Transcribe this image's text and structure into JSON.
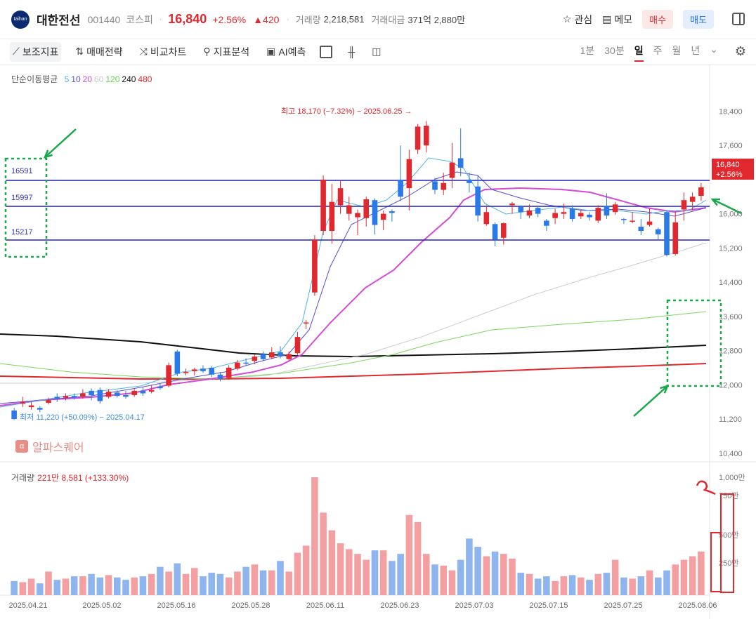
{
  "header": {
    "logo_text": "taihan",
    "name": "대한전선",
    "code": "001440",
    "market": "코스피",
    "price": "16,840",
    "change_pct": "+2.56%",
    "change_abs": "▲420",
    "volume_label": "거래량",
    "volume_value": "2,218,581",
    "amount_label": "거래대금",
    "amount_value": "371억 2,880만",
    "watch_label": "관심",
    "memo_label": "메모",
    "buy_label": "매수",
    "sell_label": "매도"
  },
  "toolbar": {
    "tools": [
      "보조지표",
      "매매전략",
      "비교차트",
      "지표분석",
      "AI예측"
    ],
    "periods": [
      "1분",
      "30분",
      "일",
      "주",
      "월",
      "년"
    ],
    "selected_period": "일"
  },
  "legend": {
    "ma_title": "단순이동평균",
    "ma_periods": [
      {
        "label": "5",
        "color": "#4fb3e8"
      },
      {
        "label": "10",
        "color": "#5a4bd6"
      },
      {
        "label": "20",
        "color": "#d64bd6"
      },
      {
        "label": "60",
        "color": "#cccccc"
      },
      {
        "label": "120",
        "color": "#5ad64b"
      },
      {
        "label": "240",
        "color": "#111111"
      },
      {
        "label": "480",
        "color": "#e0282e"
      }
    ],
    "volume_title": "거래량",
    "volume_value": "221만 8,581 (+133.30%)"
  },
  "watermark": "알파스퀘어",
  "annotations": {
    "high": "최고 18,170 (−7.32%) − 2025.06.25 →",
    "low": "← 최저 11,220 (+50.09%) − 2025.04.17"
  },
  "price_tag": {
    "price": "16,840",
    "pct": "+2.56%"
  },
  "hlines": [
    {
      "label": "16591",
      "value": 16591
    },
    {
      "label": "15997",
      "value": 15997
    },
    {
      "label": "15217",
      "value": 15217
    }
  ],
  "chart_data": {
    "type": "candlestick",
    "y_axis_ticks": [
      "18,400",
      "17,600",
      "16,000",
      "15,200",
      "14,400",
      "13,600",
      "12,800",
      "12,000",
      "11,200",
      "10,400"
    ],
    "x_axis_ticks": [
      "2025.04.21",
      "2025.05.02",
      "2025.05.16",
      "2025.05.28",
      "2025.06.11",
      "2025.06.23",
      "2025.07.03",
      "2025.07.15",
      "2025.07.25",
      "2025.08.06"
    ],
    "volume_ticks": [
      "1,000만",
      "750만",
      "500만",
      "250만"
    ],
    "ylim": [
      10200,
      18900
    ],
    "volume_max": 10000000,
    "candles": [
      [
        11400,
        11200,
        11460,
        11180
      ],
      [
        11560,
        11600,
        11720,
        11480
      ],
      [
        11480,
        11520,
        11600,
        11420
      ],
      [
        11460,
        11420,
        11500,
        11360
      ],
      [
        11580,
        11640,
        11700,
        11540
      ],
      [
        11720,
        11680,
        11800,
        11600
      ],
      [
        11700,
        11740,
        11800,
        11640
      ],
      [
        11740,
        11700,
        11800,
        11660
      ],
      [
        11720,
        11800,
        11900,
        11680
      ],
      [
        11860,
        11760,
        11920,
        11640
      ],
      [
        11880,
        11620,
        11940,
        11560
      ],
      [
        11720,
        11840,
        11900,
        11680
      ],
      [
        11820,
        11740,
        11880,
        11700
      ],
      [
        11760,
        11720,
        11860,
        11680
      ],
      [
        11760,
        11860,
        11900,
        11720
      ],
      [
        11860,
        11800,
        11940,
        11740
      ],
      [
        11840,
        11880,
        12000,
        11800
      ],
      [
        11960,
        11920,
        12040,
        11880
      ],
      [
        11980,
        12460,
        12520,
        11940
      ],
      [
        12780,
        12260,
        12820,
        12200
      ],
      [
        12280,
        12300,
        12380,
        12220
      ],
      [
        12320,
        12360,
        12400,
        12220
      ],
      [
        12380,
        12320,
        12460,
        12280
      ],
      [
        12400,
        12240,
        12440,
        12180
      ],
      [
        12240,
        12140,
        12300,
        12080
      ],
      [
        12160,
        12400,
        12460,
        12120
      ],
      [
        12380,
        12520,
        12580,
        12340
      ],
      [
        12520,
        12500,
        12620,
        12440
      ],
      [
        12560,
        12660,
        12720,
        12480
      ],
      [
        12720,
        12600,
        12780,
        12560
      ],
      [
        12640,
        12760,
        12880,
        12600
      ],
      [
        12760,
        12680,
        12900,
        12620
      ],
      [
        12600,
        12720,
        12780,
        12560
      ],
      [
        12740,
        13120,
        13240,
        12700
      ],
      [
        13440,
        13460,
        13520,
        13300
      ],
      [
        14160,
        15400,
        15500,
        14080
      ],
      [
        15600,
        16800,
        16900,
        15500
      ],
      [
        15600,
        16280,
        16700,
        15300
      ],
      [
        16200,
        16600,
        16780,
        16000
      ],
      [
        16000,
        16200,
        16400,
        15840
      ],
      [
        15920,
        16020,
        16100,
        15500
      ],
      [
        15900,
        16340,
        16400,
        15700
      ],
      [
        16320,
        15740,
        16360,
        15520
      ],
      [
        15860,
        16000,
        16080,
        15620
      ],
      [
        16060,
        16020,
        16100,
        15820
      ],
      [
        16800,
        16400,
        17600,
        16300
      ],
      [
        16600,
        17280,
        17500,
        16080
      ],
      [
        17500,
        18040,
        18100,
        17400
      ],
      [
        17600,
        18060,
        18170,
        17440
      ],
      [
        16760,
        16560,
        16840,
        16460
      ],
      [
        16560,
        16720,
        16960,
        16440
      ],
      [
        16840,
        17200,
        17660,
        16600
      ],
      [
        17300,
        17080,
        18000,
        16880
      ],
      [
        16800,
        16720,
        16960,
        16500
      ],
      [
        16640,
        15960,
        16900,
        15820
      ],
      [
        15760,
        16040,
        16200,
        15720
      ],
      [
        15760,
        15400,
        15800,
        15240
      ],
      [
        15440,
        15780,
        15800,
        15280
      ],
      [
        16200,
        16240,
        16280,
        16000
      ],
      [
        16160,
        16040,
        16200,
        15880
      ],
      [
        15960,
        16080,
        16220,
        15900
      ],
      [
        16140,
        16000,
        16180,
        15920
      ],
      [
        15840,
        15720,
        15880,
        15600
      ],
      [
        15900,
        16020,
        16120,
        15760
      ],
      [
        16000,
        16040,
        16240,
        15880
      ],
      [
        16120,
        15880,
        16200,
        15820
      ],
      [
        15940,
        16020,
        16100,
        15880
      ],
      [
        15980,
        15920,
        16040,
        15840
      ],
      [
        15840,
        16140,
        16200,
        15780
      ],
      [
        16180,
        15960,
        16480,
        15880
      ],
      [
        16040,
        16220,
        16280,
        15980
      ],
      [
        15880,
        15860,
        15900,
        15760
      ],
      [
        15820,
        15840,
        16040,
        15780
      ],
      [
        15700,
        15600,
        15880,
        15500
      ],
      [
        15740,
        15820,
        16120,
        15700
      ],
      [
        15640,
        15520,
        15680,
        15400
      ],
      [
        16040,
        15040,
        16080,
        15000
      ],
      [
        15060,
        15800,
        16060,
        15020
      ],
      [
        16100,
        16320,
        16500,
        15840
      ],
      [
        16280,
        16400,
        16500,
        16080
      ],
      [
        16420,
        16620,
        16720,
        16300
      ]
    ],
    "volumes": [
      1.2,
      1.1,
      1.4,
      1.0,
      2.0,
      1.3,
      1.4,
      1.6,
      1.6,
      1.8,
      1.5,
      1.7,
      1.5,
      1.3,
      1.5,
      1.6,
      1.8,
      2.4,
      2.0,
      2.7,
      1.8,
      2.3,
      1.6,
      1.9,
      1.8,
      1.5,
      2.0,
      2.4,
      2.6,
      2.1,
      2.1,
      2.9,
      2.0,
      3.6,
      4.2,
      10.0,
      7.0,
      5.5,
      4.4,
      3.9,
      3.5,
      3.0,
      3.8,
      3.8,
      2.9,
      3.5,
      6.8,
      6.2,
      3.5,
      2.6,
      2.5,
      2.1,
      3.0,
      4.8,
      4.1,
      3.3,
      3.7,
      3.5,
      3.1,
      1.9,
      1.8,
      1.4,
      1.6,
      1.2,
      1.6,
      1.7,
      1.5,
      1.3,
      1.8,
      1.9,
      3.0,
      1.5,
      1.4,
      1.6,
      2.1,
      1.5,
      2.1,
      2.6,
      3.0,
      3.3,
      3.7
    ]
  }
}
